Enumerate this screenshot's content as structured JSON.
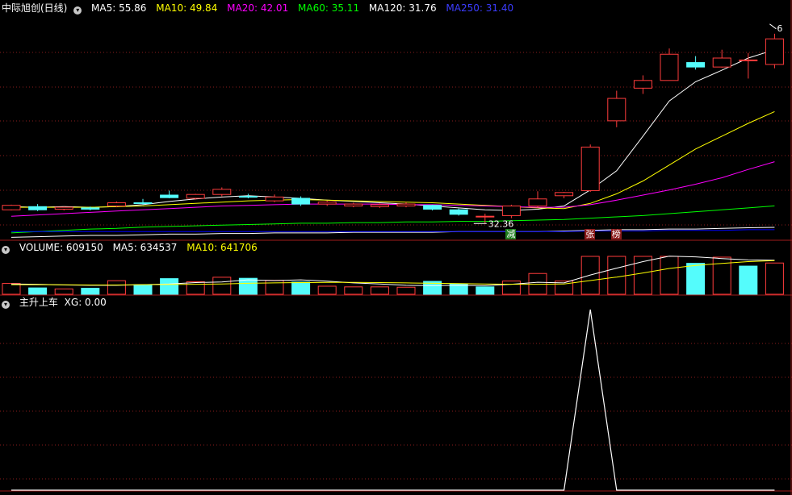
{
  "stock": {
    "title": "中际旭创(日线)",
    "ma_labels": [
      {
        "text": "MA5: 55.86",
        "color": "#ffffff"
      },
      {
        "text": "MA10: 49.84",
        "color": "#ffff00"
      },
      {
        "text": "MA20: 42.01",
        "color": "#ff00ff"
      },
      {
        "text": "MA60: 35.11",
        "color": "#00ff00"
      },
      {
        "text": "MA120: 31.76",
        "color": "#ffffff"
      },
      {
        "text": "MA250: 31.40",
        "color": "#0000ff"
      }
    ]
  },
  "volume": {
    "labels": [
      {
        "text": "VOLUME: 609150",
        "color": "#ffffff"
      },
      {
        "text": "MA5: 634537",
        "color": "#ffffff"
      },
      {
        "text": "MA10: 641706",
        "color": "#ffff00"
      }
    ]
  },
  "indicator": {
    "title": "主升上车",
    "labels": [
      {
        "text": "XG: 0.00",
        "color": "#ffffff"
      }
    ]
  },
  "annotations": {
    "low_label": "32.36",
    "high_label": "6"
  },
  "tags": [
    {
      "text": "减",
      "bg": "#1e7d1e",
      "fg": "#ffffff",
      "index": 19
    },
    {
      "text": "张",
      "bg": "#8a1a1a",
      "fg": "#ffffff",
      "index": 22
    },
    {
      "text": "榜",
      "bg": "#8a1a1a",
      "fg": "#ffffff",
      "index": 23
    }
  ],
  "colors": {
    "up": "#ff3c3c",
    "down": "#54fcfc",
    "grid": "#8a1c1c",
    "divider": "#a01c1c"
  },
  "chart_data": {
    "type": "candlestick",
    "price_range": [
      30.0,
      65.0
    ],
    "volume_range": [
      0,
      1150000
    ],
    "candles": [
      {
        "o": 34.5,
        "c": 35.2,
        "h": 35.3,
        "l": 34.4
      },
      {
        "o": 35.0,
        "c": 34.5,
        "h": 35.4,
        "l": 34.3
      },
      {
        "o": 34.6,
        "c": 34.9,
        "h": 35.0,
        "l": 34.4
      },
      {
        "o": 34.8,
        "c": 34.6,
        "h": 35.0,
        "l": 34.4
      },
      {
        "o": 35.1,
        "c": 35.6,
        "h": 35.8,
        "l": 34.9
      },
      {
        "o": 35.6,
        "c": 35.5,
        "h": 36.2,
        "l": 35.3
      },
      {
        "o": 36.8,
        "c": 36.4,
        "h": 37.5,
        "l": 36.3
      },
      {
        "o": 36.3,
        "c": 36.9,
        "h": 37.0,
        "l": 36.1
      },
      {
        "o": 36.9,
        "c": 37.7,
        "h": 38.0,
        "l": 36.6
      },
      {
        "o": 36.6,
        "c": 36.5,
        "h": 37.0,
        "l": 36.3
      },
      {
        "o": 35.9,
        "c": 36.5,
        "h": 36.9,
        "l": 35.7
      },
      {
        "o": 36.3,
        "c": 35.4,
        "h": 36.6,
        "l": 35.1
      },
      {
        "o": 35.4,
        "c": 35.7,
        "h": 35.9,
        "l": 35.1
      },
      {
        "o": 35.1,
        "c": 35.4,
        "h": 35.6,
        "l": 34.9
      },
      {
        "o": 35.0,
        "c": 35.3,
        "h": 35.5,
        "l": 34.8
      },
      {
        "o": 35.1,
        "c": 35.4,
        "h": 35.7,
        "l": 34.9
      },
      {
        "o": 35.2,
        "c": 34.6,
        "h": 35.3,
        "l": 34.4
      },
      {
        "o": 34.5,
        "c": 33.8,
        "h": 34.7,
        "l": 33.6
      },
      {
        "o": 33.5,
        "c": 33.5,
        "h": 33.9,
        "l": 32.36
      },
      {
        "o": 33.6,
        "c": 35.1,
        "h": 35.3,
        "l": 33.2
      },
      {
        "o": 35.1,
        "c": 36.2,
        "h": 37.4,
        "l": 34.9
      },
      {
        "o": 36.7,
        "c": 37.2,
        "h": 37.3,
        "l": 36.3
      },
      {
        "o": 37.5,
        "c": 44.3,
        "h": 44.7,
        "l": 37.3
      },
      {
        "o": 48.4,
        "c": 51.9,
        "h": 53.1,
        "l": 47.4
      },
      {
        "o": 53.5,
        "c": 54.7,
        "h": 55.5,
        "l": 52.6
      },
      {
        "o": 54.7,
        "c": 58.8,
        "h": 59.7,
        "l": 54.7
      },
      {
        "o": 57.5,
        "c": 56.8,
        "h": 58.5,
        "l": 56.4
      },
      {
        "o": 56.8,
        "c": 58.2,
        "h": 59.5,
        "l": 56.7
      },
      {
        "o": 57.9,
        "c": 57.9,
        "h": 59.0,
        "l": 55.0
      },
      {
        "o": 57.2,
        "c": 61.2,
        "h": 62.0,
        "l": 56.6
      }
    ],
    "volume": [
      {
        "v": 315000,
        "up": true
      },
      {
        "v": 185000,
        "up": false
      },
      {
        "v": 155000,
        "up": true
      },
      {
        "v": 175000,
        "up": false
      },
      {
        "v": 395000,
        "up": true
      },
      {
        "v": 275000,
        "up": false
      },
      {
        "v": 455000,
        "up": false
      },
      {
        "v": 365000,
        "up": true
      },
      {
        "v": 495000,
        "up": true
      },
      {
        "v": 465000,
        "up": false
      },
      {
        "v": 405000,
        "up": true
      },
      {
        "v": 355000,
        "up": false
      },
      {
        "v": 235000,
        "up": true
      },
      {
        "v": 215000,
        "up": true
      },
      {
        "v": 215000,
        "up": true
      },
      {
        "v": 205000,
        "up": true
      },
      {
        "v": 375000,
        "up": false
      },
      {
        "v": 295000,
        "up": false
      },
      {
        "v": 215000,
        "up": false
      },
      {
        "v": 385000,
        "up": true
      },
      {
        "v": 605000,
        "up": true
      },
      {
        "v": 385000,
        "up": true
      },
      {
        "v": 1220000,
        "up": true
      },
      {
        "v": 1400000,
        "up": true
      },
      {
        "v": 1300000,
        "up": true
      },
      {
        "v": 1250000,
        "up": true
      },
      {
        "v": 900000,
        "up": false
      },
      {
        "v": 1080000,
        "up": true
      },
      {
        "v": 820000,
        "up": false
      },
      {
        "v": 910000,
        "up": true
      }
    ],
    "ma_series": [
      {
        "name": "MA5",
        "color": "#ffffff",
        "values": [
          35.0,
          34.9,
          35.0,
          34.9,
          35.0,
          35.3,
          35.8,
          36.2,
          36.5,
          36.7,
          36.5,
          36.3,
          36.0,
          35.8,
          35.6,
          35.4,
          35.1,
          34.8,
          34.5,
          34.4,
          34.6,
          35.1,
          37.6,
          40.6,
          46.0,
          51.5,
          54.5,
          56.3,
          58.2,
          59.5
        ]
      },
      {
        "name": "MA10",
        "color": "#ffff00",
        "values": [
          34.9,
          34.9,
          34.9,
          34.9,
          35.0,
          35.1,
          35.3,
          35.5,
          35.7,
          35.9,
          36.0,
          36.1,
          36.0,
          35.9,
          35.8,
          35.7,
          35.6,
          35.4,
          35.2,
          35.0,
          34.8,
          34.7,
          35.5,
          37.0,
          39.0,
          41.5,
          44.0,
          46.0,
          48.0,
          49.84
        ]
      },
      {
        "name": "MA20",
        "color": "#ff00ff",
        "values": [
          33.5,
          33.7,
          33.9,
          34.1,
          34.3,
          34.5,
          34.7,
          34.9,
          35.1,
          35.2,
          35.3,
          35.4,
          35.4,
          35.4,
          35.4,
          35.3,
          35.3,
          35.2,
          35.1,
          35.0,
          34.9,
          34.9,
          35.3,
          36.0,
          36.8,
          37.6,
          38.5,
          39.5,
          40.8,
          42.01
        ]
      },
      {
        "name": "MA60",
        "color": "#00ff00",
        "values": [
          30.9,
          31.1,
          31.3,
          31.5,
          31.6,
          31.8,
          31.9,
          32.0,
          32.1,
          32.2,
          32.3,
          32.4,
          32.4,
          32.5,
          32.5,
          32.6,
          32.6,
          32.7,
          32.7,
          32.8,
          32.9,
          33.0,
          33.2,
          33.4,
          33.6,
          33.9,
          34.2,
          34.5,
          34.8,
          35.11
        ]
      },
      {
        "name": "MA120",
        "color": "#ffffff",
        "values": [
          30.2,
          30.3,
          30.4,
          30.5,
          30.5,
          30.6,
          30.7,
          30.7,
          30.8,
          30.8,
          30.9,
          30.9,
          30.9,
          31.0,
          31.0,
          31.0,
          31.0,
          31.1,
          31.1,
          31.1,
          31.1,
          31.2,
          31.3,
          31.4,
          31.4,
          31.5,
          31.5,
          31.6,
          31.7,
          31.76
        ]
      },
      {
        "name": "MA250",
        "color": "#0000ff",
        "values": [
          31.1,
          31.1,
          31.1,
          31.1,
          31.1,
          31.1,
          31.1,
          31.1,
          31.1,
          31.1,
          31.1,
          31.1,
          31.1,
          31.1,
          31.1,
          31.1,
          31.1,
          31.1,
          31.1,
          31.1,
          31.1,
          31.1,
          31.2,
          31.2,
          31.2,
          31.3,
          31.3,
          31.3,
          31.4,
          31.4
        ]
      }
    ],
    "volume_ma": [
      {
        "name": "MA5",
        "color": "#ffffff",
        "values": [
          300000,
          290000,
          270000,
          260000,
          260000,
          280000,
          300000,
          340000,
          360000,
          420000,
          400000,
          420000,
          380000,
          330000,
          300000,
          260000,
          250000,
          260000,
          250000,
          290000,
          350000,
          330000,
          560000,
          760000,
          950000,
          1110000,
          1090000,
          1040000,
          1000000,
          990000
        ]
      },
      {
        "name": "MA10",
        "color": "#ffff00",
        "values": [
          280000,
          280000,
          275000,
          270000,
          270000,
          280000,
          285000,
          290000,
          300000,
          320000,
          330000,
          340000,
          345000,
          345000,
          340000,
          330000,
          320000,
          310000,
          300000,
          290000,
          290000,
          300000,
          400000,
          500000,
          620000,
          750000,
          840000,
          900000,
          950000,
          980000
        ]
      }
    ],
    "xg_signal": [
      0,
      0,
      0,
      0,
      0,
      0,
      0,
      0,
      0,
      0,
      0,
      0,
      0,
      0,
      0,
      0,
      0,
      0,
      0,
      0,
      0,
      0,
      1,
      0,
      0,
      0,
      0,
      0,
      0,
      0
    ]
  }
}
